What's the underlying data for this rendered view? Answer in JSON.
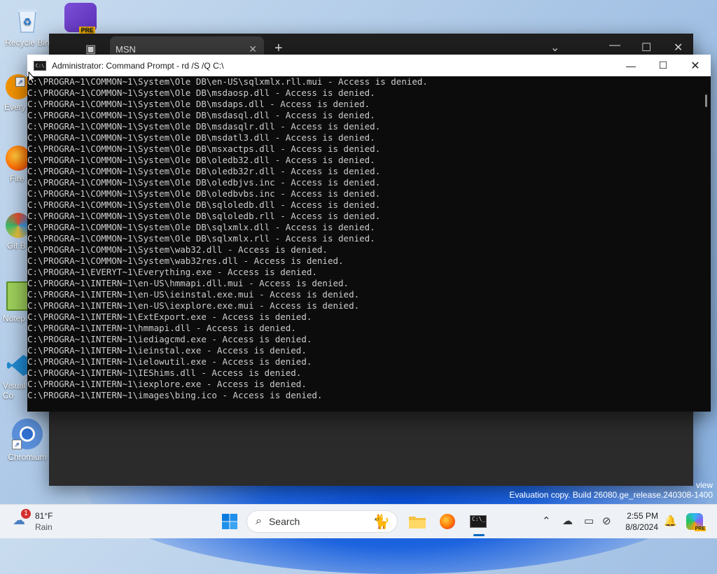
{
  "desktop": {
    "icons": [
      {
        "label": "Recycle Bin"
      },
      {
        "label": "Every"
      },
      {
        "label": "Fire"
      },
      {
        "label": "Git B"
      },
      {
        "label": "Notep"
      },
      {
        "label": "Visual S\nCo"
      },
      {
        "label": "Chromium"
      }
    ],
    "pre_badge": "PRE"
  },
  "browser": {
    "tab_title": "MSN",
    "tab_close": "✕",
    "new_tab": "+"
  },
  "cmd": {
    "title": "Administrator: Command Prompt - rd  /S /Q C:\\",
    "lines": [
      "C:\\PROGRA~1\\COMMON~1\\System\\Ole DB\\en-US\\sqlxmlx.rll.mui - Access is denied.",
      "C:\\PROGRA~1\\COMMON~1\\System\\Ole DB\\msdaosp.dll - Access is denied.",
      "C:\\PROGRA~1\\COMMON~1\\System\\Ole DB\\msdaps.dll - Access is denied.",
      "C:\\PROGRA~1\\COMMON~1\\System\\Ole DB\\msdasql.dll - Access is denied.",
      "C:\\PROGRA~1\\COMMON~1\\System\\Ole DB\\msdasqlr.dll - Access is denied.",
      "C:\\PROGRA~1\\COMMON~1\\System\\Ole DB\\msdatl3.dll - Access is denied.",
      "C:\\PROGRA~1\\COMMON~1\\System\\Ole DB\\msxactps.dll - Access is denied.",
      "C:\\PROGRA~1\\COMMON~1\\System\\Ole DB\\oledb32.dll - Access is denied.",
      "C:\\PROGRA~1\\COMMON~1\\System\\Ole DB\\oledb32r.dll - Access is denied.",
      "C:\\PROGRA~1\\COMMON~1\\System\\Ole DB\\oledbjvs.inc - Access is denied.",
      "C:\\PROGRA~1\\COMMON~1\\System\\Ole DB\\oledbvbs.inc - Access is denied.",
      "C:\\PROGRA~1\\COMMON~1\\System\\Ole DB\\sqloledb.dll - Access is denied.",
      "C:\\PROGRA~1\\COMMON~1\\System\\Ole DB\\sqloledb.rll - Access is denied.",
      "C:\\PROGRA~1\\COMMON~1\\System\\Ole DB\\sqlxmlx.dll - Access is denied.",
      "C:\\PROGRA~1\\COMMON~1\\System\\Ole DB\\sqlxmlx.rll - Access is denied.",
      "C:\\PROGRA~1\\COMMON~1\\System\\wab32.dll - Access is denied.",
      "C:\\PROGRA~1\\COMMON~1\\System\\wab32res.dll - Access is denied.",
      "C:\\PROGRA~1\\EVERYT~1\\Everything.exe - Access is denied.",
      "C:\\PROGRA~1\\INTERN~1\\en-US\\hmmapi.dll.mui - Access is denied.",
      "C:\\PROGRA~1\\INTERN~1\\en-US\\ieinstal.exe.mui - Access is denied.",
      "C:\\PROGRA~1\\INTERN~1\\en-US\\iexplore.exe.mui - Access is denied.",
      "C:\\PROGRA~1\\INTERN~1\\ExtExport.exe - Access is denied.",
      "C:\\PROGRA~1\\INTERN~1\\hmmapi.dll - Access is denied.",
      "C:\\PROGRA~1\\INTERN~1\\iediagcmd.exe - Access is denied.",
      "C:\\PROGRA~1\\INTERN~1\\ieinstal.exe - Access is denied.",
      "C:\\PROGRA~1\\INTERN~1\\ielowutil.exe - Access is denied.",
      "C:\\PROGRA~1\\INTERN~1\\IEShims.dll - Access is denied.",
      "C:\\PROGRA~1\\INTERN~1\\iexplore.exe - Access is denied.",
      "C:\\PROGRA~1\\INTERN~1\\images\\bing.ico - Access is denied."
    ]
  },
  "watermark": {
    "line1": "view",
    "line2": "Evaluation copy. Build 26080.ge_release.240308-1400"
  },
  "taskbar": {
    "weather_temp": "81°F",
    "weather_desc": "Rain",
    "weather_badge": "1",
    "search_label": "Search",
    "time": "2:55 PM",
    "date": "8/8/2024",
    "copilot_badge": "PRE"
  },
  "colors": {
    "cmd_bg": "#0c0c0c",
    "cmd_text": "#cccccc",
    "accent": "#0067c0"
  }
}
